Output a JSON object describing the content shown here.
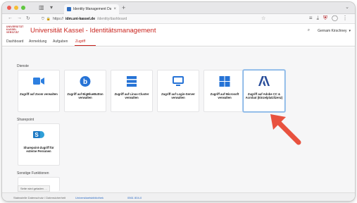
{
  "browser": {
    "tab_title": "Identity Management Dashboard",
    "new_tab": "+",
    "url_prefix": "https://",
    "url_host": "idm.uni-kassel.de",
    "url_path": "/identity/dashboard",
    "colors": {
      "traffic_red": "#ee5e56",
      "traffic_yellow": "#f5bd33",
      "traffic_green": "#5fc73f"
    }
  },
  "site": {
    "logo_text": "UNIVERSITÄT KASSEL VERSITÄT",
    "title": "Universität Kassel - Identitätsmanagement",
    "user_name": "Gernam Kirschney",
    "accent_color": "#c9241e"
  },
  "nav": {
    "items": [
      {
        "label": "Dashboard"
      },
      {
        "label": "Anmeldung"
      },
      {
        "label": "Aufgaben"
      },
      {
        "label": "Zugriff"
      }
    ],
    "active_index": 3
  },
  "sections": {
    "dienste": "Dienste",
    "sharepoint": "Sharepoint",
    "sonstige": "Sonstige Funktionen"
  },
  "dienste_cards": [
    {
      "label": "Zugriff auf Zoom verwalten",
      "icon": "zoom-camera-icon"
    },
    {
      "label": "Zugriff auf BigBlueButton verwalten",
      "icon": "bigbluebutton-icon"
    },
    {
      "label": "Zugriff auf Linux-Cluster verwalten",
      "icon": "server-stack-icon"
    },
    {
      "label": "Zugriff auf Login-Server verwalten",
      "icon": "monitor-icon"
    },
    {
      "label": "Zugriff auf Microsoft verwalten",
      "icon": "windows-logo-icon"
    },
    {
      "label": "Zugriff auf Adobe CC & Acrobat (Einzelplatzlizenz)",
      "icon": "adobe-logo-icon"
    }
  ],
  "sharepoint_cards": [
    {
      "label": "Sharepoint-Zugriff für externe Personen",
      "icon": "sharepoint-icon"
    }
  ],
  "footer": {
    "text": "Stabsstelle Datenschutz / Datensicherheit",
    "link1": "Universitaetsbibliothek",
    "link2": "0561 804-0",
    "tooltip": "Seite wird geladen …"
  }
}
